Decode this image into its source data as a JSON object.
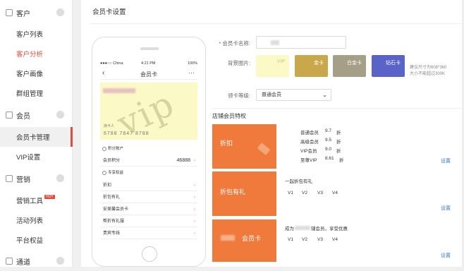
{
  "sidebar": {
    "groups": [
      {
        "label": "客户",
        "icon": "customer-icon"
      },
      {
        "label": "会员",
        "icon": "member-icon"
      },
      {
        "label": "营销",
        "icon": "marketing-icon"
      },
      {
        "label": "通道",
        "icon": "channel-icon"
      }
    ],
    "items": [
      {
        "label": "客户列表"
      },
      {
        "label": "客户分析"
      },
      {
        "label": "客户画像"
      },
      {
        "label": "群组管理"
      },
      {
        "label": "会员卡管理"
      },
      {
        "label": "VIP设置"
      },
      {
        "label": "营销工具"
      },
      {
        "label": "活动列表"
      },
      {
        "label": "平台权益"
      }
    ],
    "hot_badge": "HOT",
    "accent": "#e24a3a"
  },
  "page": {
    "title": "会员卡设置"
  },
  "phone": {
    "carrier": "●●●○○ China",
    "time": "4:21 PM",
    "battery": "100%",
    "nav_title": "会员卡",
    "back": "‹",
    "more": "···",
    "card": {
      "watermark": "vip",
      "holder": "持卡人",
      "number": "6788 7847 8788"
    },
    "points_section": "积分账户",
    "points_label": "会员积分",
    "points_value": "46888",
    "benefits_section": "专享权益",
    "benefits": [
      "折扣",
      "折包有礼",
      "安美馨会员卡",
      "帮折有礼服",
      "贵宾专线"
    ]
  },
  "form": {
    "name_label": "会员卡名称:",
    "bg_label": "背景图片:",
    "bg_options": [
      {
        "label": "VIP",
        "color": "#fbf9c6"
      },
      {
        "label": "金卡",
        "color": "#c8a84a"
      },
      {
        "label": "白金卡",
        "color": "#a59f88"
      },
      {
        "label": "钻石卡",
        "color": "#5a63c7"
      }
    ],
    "bg_hint_1": "建议尺寸为608*360",
    "bg_hint_2": "大小不能超过300K",
    "level_label": "领卡等级:",
    "level_value": "普通会员"
  },
  "privileges": {
    "title": "店铺会员特权",
    "discount": {
      "label": "折扣",
      "rows": [
        {
          "level": "普通会员",
          "value": "9.7",
          "unit": "折"
        },
        {
          "level": "高级会员",
          "value": "9.5",
          "unit": "折"
        },
        {
          "level": "VIP会员",
          "value": "9.0",
          "unit": "折"
        },
        {
          "level": "至尊VIP",
          "value": "8.61",
          "unit": "折"
        }
      ]
    },
    "gift": {
      "label": "折包有礼",
      "desc": "一起折包有礼",
      "levels": [
        "V1",
        "V2",
        "V3",
        "V4"
      ]
    },
    "card": {
      "label": "会员卡",
      "desc_prefix": "成为",
      "desc_suffix": "铺会员，享受优惠",
      "levels": [
        "V1",
        "V2",
        "V3",
        "V4"
      ]
    },
    "setting_label": "设置",
    "color": "#f07a3c"
  }
}
